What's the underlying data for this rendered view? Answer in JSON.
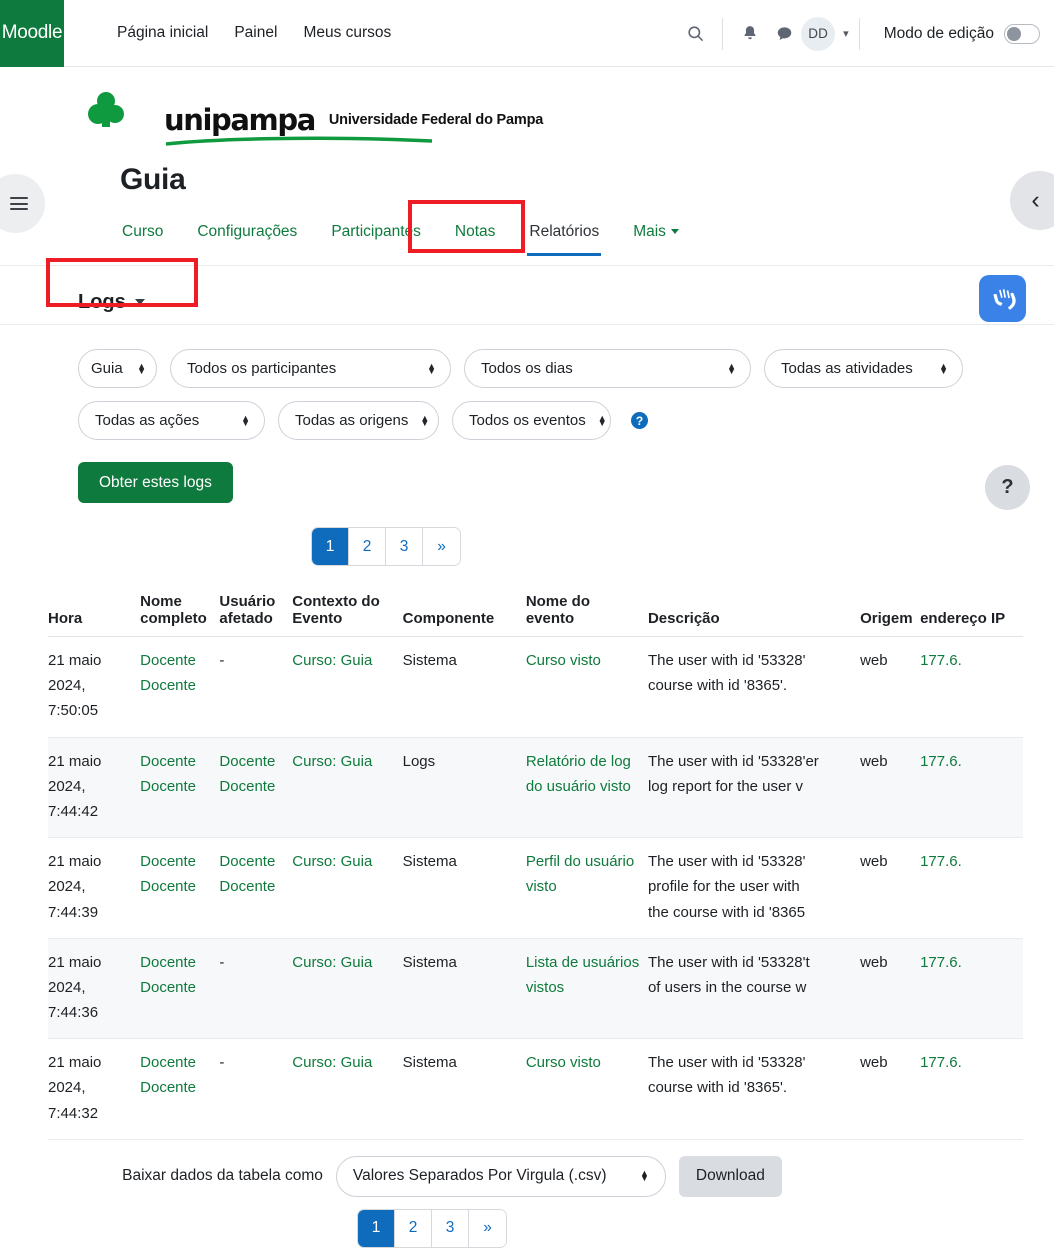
{
  "navbar": {
    "brand": "Moodle",
    "links": [
      "Página inicial",
      "Painel",
      "Meus cursos"
    ],
    "search_icon": "search-icon",
    "notifications_icon": "bell-icon",
    "messages_icon": "message-icon",
    "avatar_initials": "DD",
    "edit_mode_label": "Modo de edição",
    "edit_mode_on": false
  },
  "branding": {
    "word": "unipampa",
    "tagline": "Universidade Federal do Pampa"
  },
  "course": {
    "title": "Guia",
    "tabs": [
      {
        "label": "Curso",
        "active": false,
        "has_caret": false
      },
      {
        "label": "Configurações",
        "active": false,
        "has_caret": false
      },
      {
        "label": "Participantes",
        "active": false,
        "has_caret": false
      },
      {
        "label": "Notas",
        "active": false,
        "has_caret": false
      },
      {
        "label": "Relatórios",
        "active": true,
        "has_caret": false
      },
      {
        "label": "Mais",
        "active": false,
        "has_caret": true
      }
    ]
  },
  "report_selector": {
    "label": "Logs"
  },
  "filters": {
    "course": "Guia",
    "participants": "Todos os participantes",
    "days": "Todos os dias",
    "activities": "Todas as atividades",
    "actions": "Todas as ações",
    "origins": "Todas as origens",
    "events": "Todos os eventos",
    "help_glyph": "?",
    "submit_label": "Obter estes logs"
  },
  "pagination": {
    "pages": [
      "1",
      "2",
      "3"
    ],
    "next_glyph": "»",
    "current": "1"
  },
  "table": {
    "headers": {
      "time": "Hora",
      "fullname_line1": "Nome",
      "fullname_line2": "completo",
      "affected_line1": "Usuário",
      "affected_line2": "afetado",
      "context_line1": "Contexto do",
      "context_line2": "Evento",
      "component": "Componente",
      "eventname_line1": "Nome do",
      "eventname_line2": "evento",
      "description": "Descrição",
      "origin": "Origem",
      "ip": "endereço IP"
    },
    "rows": [
      {
        "time": "21 maio 2024, 7:50:05",
        "fullname": "Docente Docente",
        "affected": "-",
        "context": "Curso: Guia",
        "component": "Sistema",
        "event": "Curso visto",
        "desc_lines": [
          "The user with id '53328'",
          "course with id '8365'."
        ],
        "origin": "web",
        "ip": "177.6."
      },
      {
        "time": "21 maio 2024, 7:44:42",
        "fullname": "Docente Docente",
        "affected": "Docente Docente",
        "context": "Curso: Guia",
        "component": "Logs",
        "event": "Relatório de log do usuário visto",
        "desc_lines": [
          "The user with id '53328'er",
          "log report for the user v"
        ],
        "origin": "web",
        "ip": "177.6."
      },
      {
        "time": "21 maio 2024, 7:44:39",
        "fullname": "Docente Docente",
        "affected": "Docente Docente",
        "context": "Curso: Guia",
        "component": "Sistema",
        "event": "Perfil do usuário visto",
        "desc_lines": [
          "The user with id '53328'",
          "profile for the user with",
          "the course with id '8365"
        ],
        "origin": "web",
        "ip": "177.6."
      },
      {
        "time": "21 maio 2024, 7:44:36",
        "fullname": "Docente Docente",
        "affected": "-",
        "context": "Curso: Guia",
        "component": "Sistema",
        "event": "Lista de usuários vistos",
        "desc_lines": [
          "The user with id '53328't",
          "of users in the course w"
        ],
        "origin": "web",
        "ip": "177.6."
      },
      {
        "time": "21 maio 2024, 7:44:32",
        "fullname": "Docente Docente",
        "affected": "-",
        "context": "Curso: Guia",
        "component": "Sistema",
        "event": "Curso visto",
        "desc_lines": [
          "The user with id '53328'",
          "course with id '8365'."
        ],
        "origin": "web",
        "ip": "177.6."
      }
    ]
  },
  "download": {
    "label": "Baixar dados da tabela como",
    "format": "Valores Separados Por Virgula (.csv)",
    "button": "Download"
  },
  "floating": {
    "vlibras_icon": "sign-language-hands-icon",
    "help_glyph": "?",
    "block_drawer_glyph": "‹"
  },
  "colors": {
    "brand_green": "#0f7a3d",
    "link_green": "#0f7a3d",
    "accent_blue": "#0f6cbd",
    "annotation_red": "#ee1c25",
    "vlibras_blue": "#3b82e8"
  }
}
